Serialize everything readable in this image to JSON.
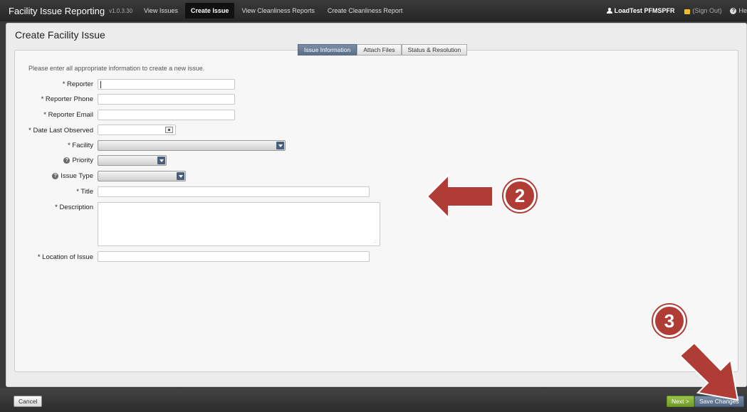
{
  "app": {
    "title": "Facility Issue Reporting",
    "version": "v1.0.3.30"
  },
  "nav": {
    "tabs": [
      {
        "label": "View Issues"
      },
      {
        "label": "Create Issue"
      },
      {
        "label": "View Cleanliness Reports"
      },
      {
        "label": "Create Cleanliness Report"
      }
    ],
    "user": "LoadTest PFMSPFR",
    "sign_out": "(Sign Out)",
    "help": "He"
  },
  "page": {
    "title": "Create Facility Issue",
    "subtabs": [
      {
        "label": "Issue Information"
      },
      {
        "label": "Attach Files"
      },
      {
        "label": "Status & Resolution"
      }
    ],
    "intro": "Please enter all appropriate information to create a new issue."
  },
  "form": {
    "reporter": {
      "label": "* Reporter",
      "value": ""
    },
    "reporter_phone": {
      "label": "* Reporter Phone",
      "value": ""
    },
    "reporter_email": {
      "label": "* Reporter Email",
      "value": ""
    },
    "date_last_observed": {
      "label": "* Date Last Observed",
      "value": ""
    },
    "facility": {
      "label": "* Facility",
      "value": ""
    },
    "priority": {
      "label": "Priority",
      "value": ""
    },
    "issue_type": {
      "label": "Issue Type",
      "value": ""
    },
    "title": {
      "label": "* Title",
      "value": ""
    },
    "description": {
      "label": "* Description",
      "value": ""
    },
    "location": {
      "label": "* Location of Issue",
      "value": ""
    }
  },
  "footer": {
    "cancel": "Cancel",
    "next": "Next >",
    "save": "Save Changes"
  },
  "annotations": {
    "badge_2": "2",
    "badge_3": "3"
  },
  "colors": {
    "topbar": "#2a2a2a",
    "accent_blue": "#5b6f8a",
    "next_green": "#7aa532",
    "annotation_red": "#b03c36"
  }
}
